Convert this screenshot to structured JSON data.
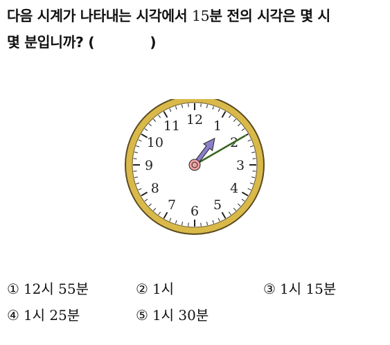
{
  "question": {
    "part1": "다음 시계가 나타내는 시각에서 ",
    "number": "15",
    "part2": "분 전의 시각은  몇 시",
    "part3": "몇 분입니까? (",
    "part4": ")"
  },
  "clock": {
    "numbers": [
      "12",
      "1",
      "2",
      "3",
      "4",
      "5",
      "6",
      "7",
      "8",
      "9",
      "10",
      "11"
    ],
    "colors": {
      "rim": "#d9b94a",
      "face": "#ffffff",
      "hour_hand": "#8a80c8",
      "minute_hand": "#5e9a3a",
      "center": "#f2a4a4"
    }
  },
  "choices": [
    {
      "mark": "①",
      "text": "12시 55분"
    },
    {
      "mark": "②",
      "text": "1시"
    },
    {
      "mark": "③",
      "text": "1시 15분"
    },
    {
      "mark": "④",
      "text": "1시 25분"
    },
    {
      "mark": "⑤",
      "text": "1시 30분"
    }
  ]
}
